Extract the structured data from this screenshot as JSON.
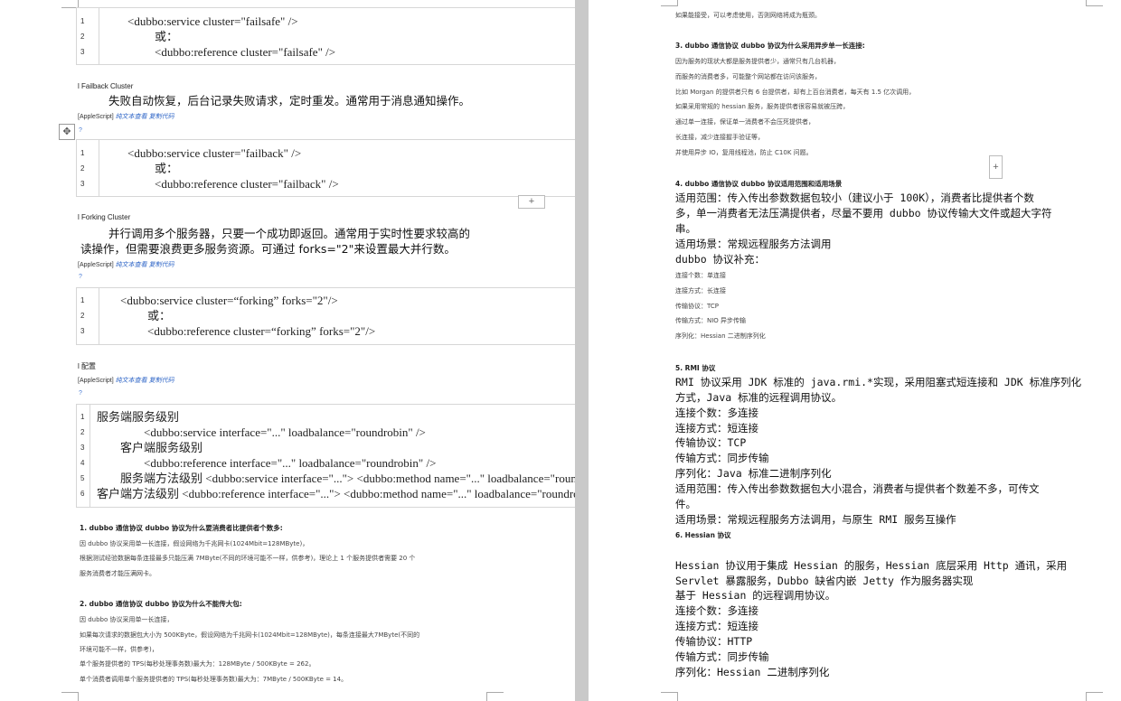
{
  "left": {
    "code1": [
      {
        "n": "1",
        "t": "<dubbo:service cluster=\"failsafe\"  />"
      },
      {
        "n": "2",
        "t": "或："
      },
      {
        "n": "3",
        "t": "<dubbo:reference  cluster=\"failsafe\"  />"
      }
    ],
    "failback_title": "l Failback Cluster",
    "failback_desc": "失败自动恢复，后台记录失败请求，定时重发。通常用于消息通知操作。",
    "applescript_label": "[AppleScript]",
    "applescript_link": "纯文本查看 复制代码",
    "qmark": "?",
    "code2": [
      {
        "n": "1",
        "t": "<dubbo:service cluster=\"failback\"  />"
      },
      {
        "n": "2",
        "t": "或："
      },
      {
        "n": "3",
        "t": "<dubbo:reference  cluster=\"failback\"  />"
      }
    ],
    "add_label": "+",
    "forking_title": "l Forking Cluster",
    "forking_desc_1": "并行调用多个服务器，只要一个成功即返回。通常用于实时性要求较高的",
    "forking_desc_2": "读操作，但需要浪费更多服务资源。可通过 forks=\"2\"来设置最大并行数。",
    "code3": [
      {
        "n": "1",
        "t": "<dubbo:service cluster=“forking” forks=\"2\"/>"
      },
      {
        "n": "2",
        "t": "或："
      },
      {
        "n": "3",
        "t": "<dubbo:reference cluster=“forking”  forks=\"2\"/>"
      }
    ],
    "config_title": "l 配置",
    "code4": [
      {
        "n": "1",
        "t": "服务端服务级别"
      },
      {
        "n": "2",
        "t": "<dubbo:service interface=\"...\"  loadbalance=\"roundrobin\"  />"
      },
      {
        "n": "3",
        "t": "客户端服务级别"
      },
      {
        "n": "4",
        "t": "<dubbo:reference   interface=\"...\"  loadbalance=\"roundrobin\"  />"
      },
      {
        "n": "5",
        "t": "服务端方法级别          <dubbo:service interface=\"...\">  <dubbo:method name=\"...\"  loadbalance=\"roundrobin\"/>"
      },
      {
        "n": "6",
        "t": "客户端方法级别          <dubbo:reference   interface=\"...\">  <dubbo:method name=\"...\"  loadbalance=\"roundrobin\"/>"
      }
    ],
    "q1_title": "1. dubbo 通信协议 dubbo 协议为什么要消费者比提供者个数多:",
    "q1_lines": [
      "因 dubbo 协议采用单一长连接，假设网络为千兆网卡(1024Mbit=128MByte)，",
      "根据测试经验数据每条连接最多只能压满 7MByte(不同的环境可能不一样，供参考)，理论上 1 个服务提供者需要 20 个",
      "服务消费者才能压满网卡。"
    ],
    "q2_title": "2. dubbo 通信协议 dubbo 协议为什么不能传大包:",
    "q2_lines": [
      "因 dubbo 协议采用单一长连接，",
      "如果每次请求的数据包大小为 500KByte，假设网络为千兆网卡(1024Mbit=128MByte)，每条连接最大7MByte(不同的",
      "环境可能不一样，供参考)，",
      "单个服务提供者的 TPS(每秒处理事务数)最大为：128MByte / 500KByte = 262。",
      "单个消费者调用单个服务提供者的 TPS(每秒处理事务数)最大为：7MByte / 500KByte = 14。"
    ]
  },
  "right": {
    "top_line": "如果能接受，可以考虑使用，否则网络将成为瓶颈。",
    "q3_title": "3. dubbo 通信协议 dubbo 协议为什么采用异步单一长连接:",
    "q3_lines": [
      "因为服务的现状大都是服务提供者少，通常只有几台机器，",
      "而服务的消费者多，可能整个网站都在访问该服务，",
      "比如 Morgan 的提供者只有 6 台提供者，却有上百台消费者，每天有 1.5 亿次调用，",
      "如果采用常规的 hessian 服务，服务提供者很容易就被压跨，",
      "通过单一连接，保证单一消费者不会压死提供者，",
      "长连接，减少连接握手验证等，",
      "并使用异步 IO，复用线程池，防止 C10K 问题。"
    ],
    "add_label": "+",
    "q4_title": "4. dubbo 通信协议 dubbo 协议适用范围和适用场景",
    "q4_lines": [
      "适用范围：传入传出参数数据包较小（建议小于 100K），消费者比提供者个数",
      "多，单一消费者无法压满提供者，尽量不要用 dubbo 协议传输大文件或超大字符",
      "串。",
      "适用场景：常规远程服务方法调用",
      "dubbo 协议补充："
    ],
    "q4_small": [
      "连接个数：单连接",
      "连接方式：长连接",
      "传输协议：TCP",
      "传输方式：NIO 异步传输",
      "序列化：Hessian 二进制序列化"
    ],
    "q5_title": "5. RMI 协议",
    "q5_lines": [
      "RMI 协议采用 JDK 标准的 java.rmi.*实现，采用阻塞式短连接和 JDK 标准序列化",
      "方式，Java 标准的远程调用协议。",
      "连接个数：多连接",
      "连接方式：短连接",
      "传输协议：TCP",
      "传输方式：同步传输",
      "序列化：Java 标准二进制序列化",
      "适用范围：传入传出参数数据包大小混合，消费者与提供者个数差不多，可传文",
      "件。",
      "适用场景：常规远程服务方法调用，与原生 RMI 服务互操作"
    ],
    "q6_title": "6. Hessian 协议",
    "q6_lines": [
      "Hessian 协议用于集成 Hessian 的服务，Hessian 底层采用 Http 通讯，采用",
      "Servlet 暴露服务，Dubbo 缺省内嵌 Jetty 作为服务器实现",
      "基于 Hessian 的远程调用协议。",
      "连接个数：多连接",
      "连接方式：短连接",
      "传输协议：HTTP",
      "传输方式：同步传输",
      "序列化：Hessian 二进制序列化"
    ]
  }
}
